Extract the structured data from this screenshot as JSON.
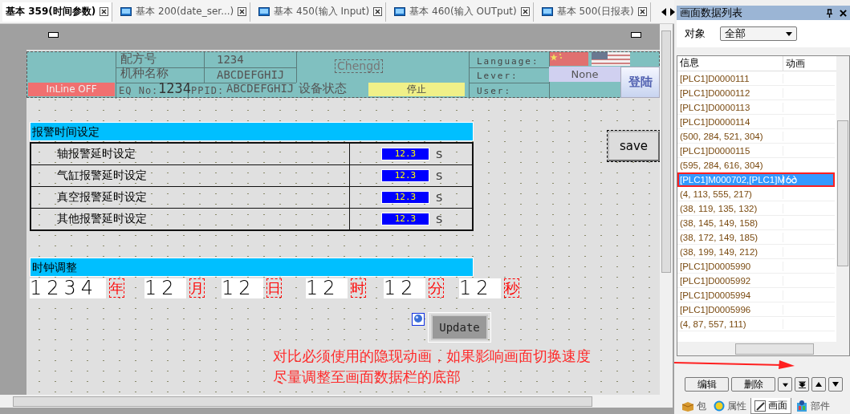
{
  "tabs": [
    {
      "label": "基本 359(时间参数)",
      "selected": true
    },
    {
      "label": "基本 200(date_ser...)",
      "selected": false
    },
    {
      "label": "基本 450(输入 Input)",
      "selected": false
    },
    {
      "label": "基本 460(输入 OUTput)",
      "selected": false
    },
    {
      "label": "基本 500(日报表)",
      "selected": false
    }
  ],
  "header": {
    "recipe_label": "配方号",
    "recipe_value": "1234",
    "model_label": "机种名称",
    "model_value": "ABCDEFGHIJ",
    "chengd": "Chengd",
    "inline_status": "InLine OFF",
    "eq_label": "EQ No:",
    "eq_value": "1234",
    "ppid_label": "PPID:",
    "ppid_value": "ABCDEFGHIJ",
    "device_label": "设备状态",
    "device_status": "停止",
    "language_label": "Language:",
    "lever_label": "Lever:",
    "lever_value": "None",
    "user_label": "User:",
    "login": "登陆"
  },
  "alarm": {
    "title": "报警时间设定",
    "rows": [
      {
        "label": "轴报警延时设定",
        "value": "12.3",
        "unit": "S"
      },
      {
        "label": "气缸报警延时设定",
        "value": "12.3",
        "unit": "S"
      },
      {
        "label": "真空报警延时设定",
        "value": "12.3",
        "unit": "S"
      },
      {
        "label": "其他报警延时设定",
        "value": "12.3",
        "unit": "S"
      }
    ]
  },
  "save": "save",
  "clock": {
    "title": "时钟调整",
    "parts": [
      {
        "value": "1234",
        "unit": "年"
      },
      {
        "value": "12",
        "unit": "月"
      },
      {
        "value": "12",
        "unit": "日"
      },
      {
        "value": "12",
        "unit": "时"
      },
      {
        "value": "12",
        "unit": "分"
      },
      {
        "value": "12",
        "unit": "秒"
      }
    ]
  },
  "update": "Update",
  "note": [
    "对比必须使用的隐现动画，如果影响画面切换速度",
    "尽量调整至画面数据栏的底部"
  ],
  "panel": {
    "title": "画面数据列表",
    "filter_label": "对象",
    "filter_value": "全部",
    "columns": [
      "信息",
      "动画"
    ],
    "rows": [
      {
        "info": "[PLC1]D0000111",
        "selected": false,
        "animated": false
      },
      {
        "info": "[PLC1]D0000112",
        "selected": false,
        "animated": false
      },
      {
        "info": "[PLC1]D0000113",
        "selected": false,
        "animated": false
      },
      {
        "info": "[PLC1]D0000114",
        "selected": false,
        "animated": false
      },
      {
        "info": "(500, 284, 521, 304)",
        "selected": false,
        "animated": false
      },
      {
        "info": "[PLC1]D0000115",
        "selected": false,
        "animated": false
      },
      {
        "info": "(595, 284, 616, 304)",
        "selected": false,
        "animated": false
      },
      {
        "info": "[PLC1]M000702,[PLC1]M",
        "selected": true,
        "animated": true
      },
      {
        "info": "(4, 113, 555, 217)",
        "selected": false,
        "animated": false
      },
      {
        "info": "(38, 119, 135, 132)",
        "selected": false,
        "animated": false
      },
      {
        "info": "(38, 145, 149, 158)",
        "selected": false,
        "animated": false
      },
      {
        "info": "(38, 172, 149, 185)",
        "selected": false,
        "animated": false
      },
      {
        "info": "(38, 199, 149, 212)",
        "selected": false,
        "animated": false
      },
      {
        "info": "[PLC1]D0005990",
        "selected": false,
        "animated": false
      },
      {
        "info": "[PLC1]D0005992",
        "selected": false,
        "animated": false
      },
      {
        "info": "[PLC1]D0005994",
        "selected": false,
        "animated": false
      },
      {
        "info": "[PLC1]D0005996",
        "selected": false,
        "animated": false
      },
      {
        "info": "(4, 87, 557, 111)",
        "selected": false,
        "animated": false
      }
    ],
    "buttons": [
      "编辑",
      "删除"
    ],
    "tabs": [
      {
        "label": "包",
        "selected": false
      },
      {
        "label": "属性",
        "selected": false
      },
      {
        "label": "画面",
        "selected": true
      },
      {
        "label": "部件",
        "selected": false
      }
    ]
  }
}
